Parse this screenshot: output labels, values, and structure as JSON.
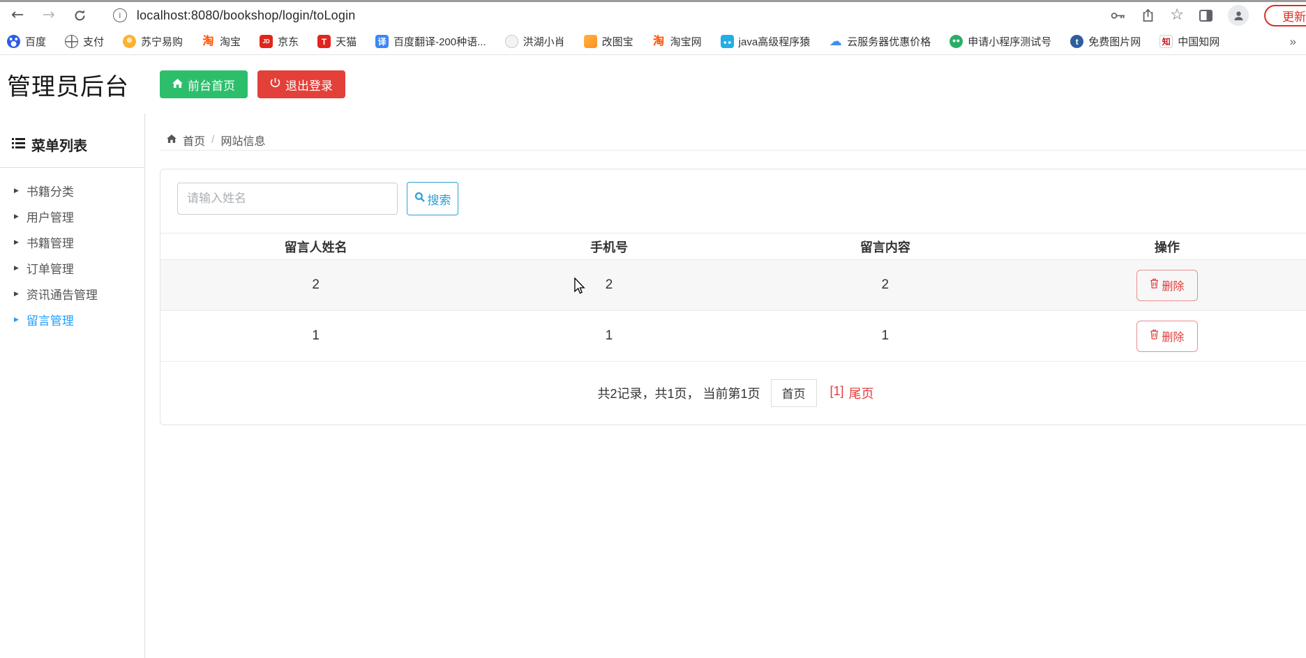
{
  "browser": {
    "url": "localhost:8080/bookshop/login/toLogin",
    "update_label": "更新",
    "overflow_chevron": "»"
  },
  "bookmarks": [
    {
      "label": "百度",
      "glyph": ""
    },
    {
      "label": "支付",
      "glyph": ""
    },
    {
      "label": "苏宁易购",
      "glyph": ""
    },
    {
      "label": "淘宝",
      "glyph": "淘"
    },
    {
      "label": "京东",
      "glyph": "JD"
    },
    {
      "label": "天猫",
      "glyph": "T"
    },
    {
      "label": "百度翻译-200种语...",
      "glyph": "译"
    },
    {
      "label": "洪湖小肖",
      "glyph": ""
    },
    {
      "label": "改图宝",
      "glyph": ""
    },
    {
      "label": "淘宝网",
      "glyph": "淘"
    },
    {
      "label": "java高级程序猿",
      "glyph": ""
    },
    {
      "label": "云服务器优惠价格",
      "glyph": "☁"
    },
    {
      "label": "申请小程序测试号",
      "glyph": ""
    },
    {
      "label": "免费图片网",
      "glyph": "t"
    },
    {
      "label": "中国知网",
      "glyph": "知"
    }
  ],
  "header": {
    "title": "管理员后台",
    "home_button": "前台首页",
    "logout_button": "退出登录"
  },
  "sidebar": {
    "heading": "菜单列表",
    "items": [
      {
        "label": "书籍分类"
      },
      {
        "label": "用户管理"
      },
      {
        "label": "书籍管理"
      },
      {
        "label": "订单管理"
      },
      {
        "label": "资讯通告管理"
      },
      {
        "label": "留言管理"
      }
    ]
  },
  "breadcrumb": {
    "home": "首页",
    "separator": "/",
    "current": "网站信息"
  },
  "search": {
    "placeholder": "请输入姓名",
    "button_label": "搜索"
  },
  "table": {
    "headers": [
      "留言人姓名",
      "手机号",
      "留言内容",
      "操作"
    ],
    "rows": [
      {
        "name": "2",
        "phone": "2",
        "content": "2",
        "delete_label": "删除"
      },
      {
        "name": "1",
        "phone": "1",
        "content": "1",
        "delete_label": "删除"
      }
    ]
  },
  "pagination": {
    "summary": "共2记录，共1页， 当前第1页",
    "first_label": "首页",
    "current_page": "[1]",
    "last_label": "尾页"
  },
  "colors": {
    "accent_blue": "#2d9fd8",
    "active_menu_blue": "#1e9fff",
    "danger_red": "#e23c3c",
    "success_green": "#2dbe6c"
  }
}
